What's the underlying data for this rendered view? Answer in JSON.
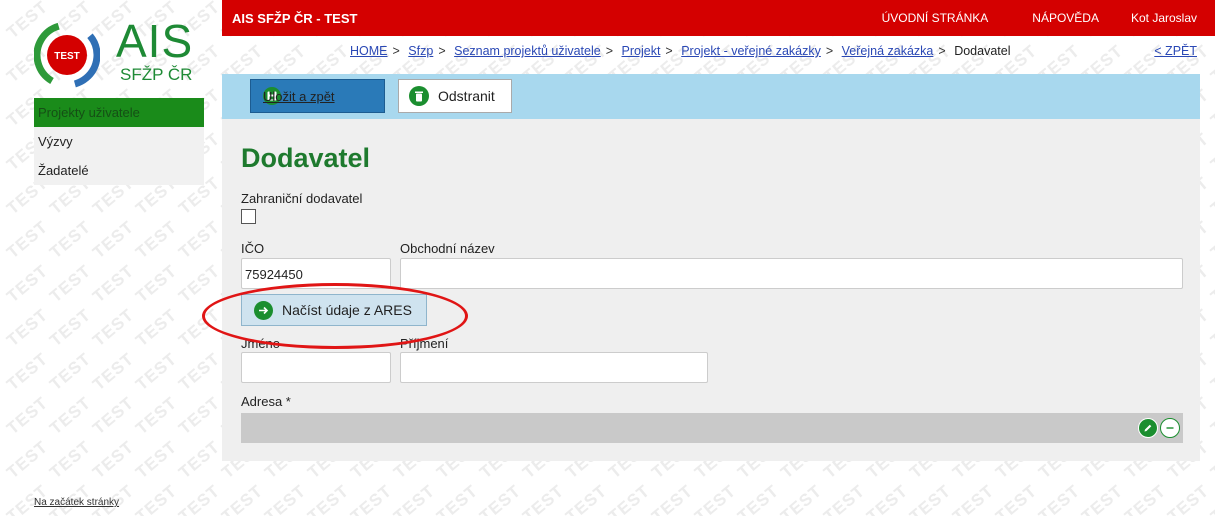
{
  "topbar": {
    "title": "AIS SFŽP ČR - TEST",
    "home_link": "ÚVODNÍ STRÁNKA",
    "help_link": "NÁPOVĚDA",
    "user": "Kot Jaroslav"
  },
  "logo": {
    "badge": "TEST",
    "name": "AIS",
    "sub": "SFŽP ČR"
  },
  "sidebar": {
    "items": [
      {
        "label": "Projekty uživatele",
        "active": true
      },
      {
        "label": "Výzvy"
      },
      {
        "label": "Žadatelé"
      }
    ]
  },
  "breadcrumb": {
    "items": [
      "HOME",
      "Sfzp",
      "Seznam projektů uživatele",
      "Projekt",
      "Projekt - veřejné zakázky",
      "Veřejná zakázka"
    ],
    "separator": ">",
    "current": "Dodavatel",
    "back": "< ZPĚT"
  },
  "toolbar": {
    "save_label": "Uložit a zpět",
    "delete_label": "Odstranit"
  },
  "form": {
    "title": "Dodavatel",
    "foreign_label": "Zahraniční dodavatel",
    "ico_label": "IČO",
    "ico_value": "75924450",
    "name_label": "Obchodní název",
    "name_value": "",
    "ares_button": "Načíst údaje z ARES",
    "first_name_label": "Jméno",
    "last_name_label": "Příjmení",
    "address_label": "Adresa *"
  },
  "footer": {
    "top_link": "Na začátek stránky"
  },
  "colors": {
    "topbar": "#d40000",
    "accent_green": "#1b8e2f",
    "toolbar": "#a8d8ee",
    "annotation": "#e01515"
  },
  "watermark": "TEST"
}
